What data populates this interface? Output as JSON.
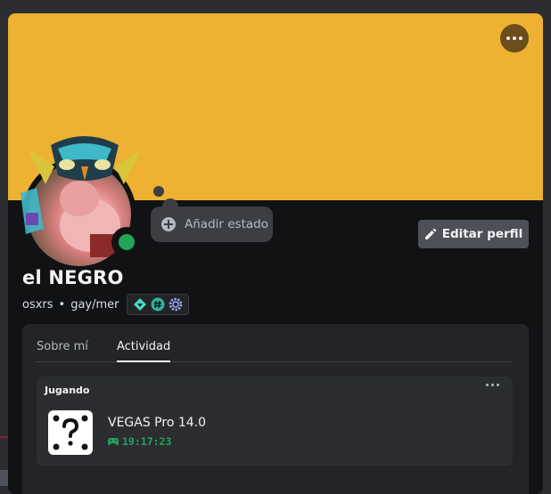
{
  "profile": {
    "display_name": "el NEGRO",
    "username": "osxrs",
    "separator": "•",
    "pronouns": "gay/mer",
    "add_status_label": "Añadir estado",
    "edit_profile_label": "Editar perfil",
    "banner_color": "#efb132",
    "status_color": "#23a55a",
    "badges": [
      "hypesquad-balance-icon",
      "hashtag-icon",
      "gear-badge-icon"
    ]
  },
  "tabs": [
    {
      "label": "Sobre mí",
      "active": false
    },
    {
      "label": "Actividad",
      "active": true
    }
  ],
  "activity": {
    "header": "Jugando",
    "game_name": "VEGAS Pro 14.0",
    "elapsed": "19:17:23",
    "icon": "unknown-game-icon"
  }
}
